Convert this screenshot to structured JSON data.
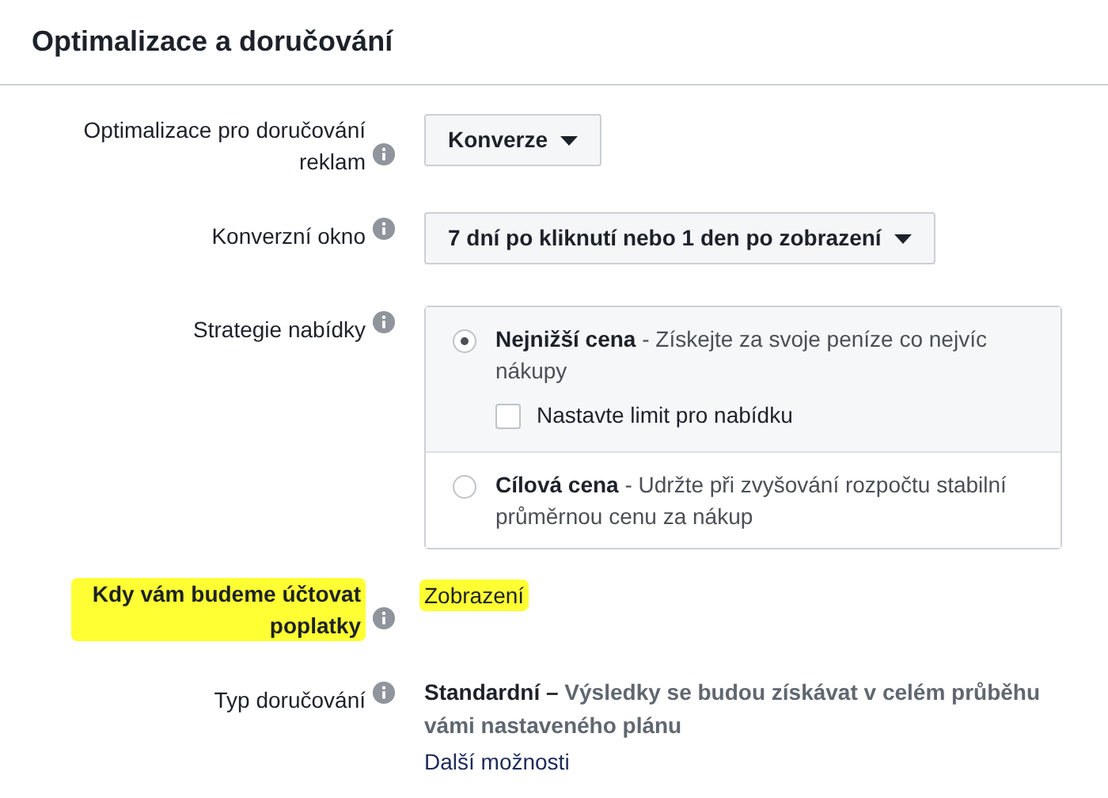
{
  "section_title": "Optimalizace a doručování",
  "rows": [
    {
      "kind": "dropdown",
      "label": "Optimalizace pro doručování reklam",
      "highlighted": false,
      "value": "Konverze"
    },
    {
      "kind": "dropdown",
      "label": "Konverzní okno",
      "highlighted": false,
      "value": "7 dní po kliknutí nebo 1 den po zobrazení"
    },
    {
      "kind": "options",
      "label": "Strategie nabídky",
      "highlighted": false,
      "options": [
        {
          "text": "**Nejnižší cena** - Získejte za svoje peníze co nejvíc nákupy",
          "selected": true,
          "checkbox": {
            "label": "Nastavte limit pro nabídku",
            "checked": false
          }
        },
        {
          "text": "**Cílová cena** - Udržte při zvyšování rozpočtu stabilní průměrnou cenu za nákup",
          "selected": false
        }
      ]
    },
    {
      "kind": "text",
      "label": "Kdy vám budeme účtovat poplatky",
      "highlighted": true,
      "value": "Zobrazení"
    },
    {
      "kind": "delivery",
      "label": "Typ doručování",
      "highlighted": false,
      "text": "**Standardní –** Výsledky se budou získávat v celém průběhu vámi nastaveného plánu",
      "link": "Další možnosti"
    }
  ]
}
